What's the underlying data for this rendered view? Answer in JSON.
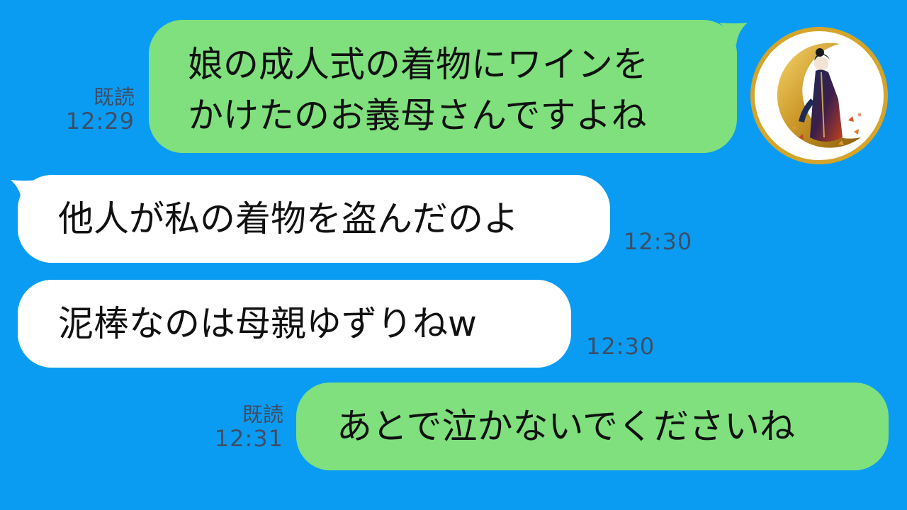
{
  "colors": {
    "background": "#0a9cf2",
    "sent_bubble": "#7fe07d",
    "received_bubble": "#ffffff",
    "meta_text": "#3d4e66",
    "avatar_ring": "#d4a52a"
  },
  "messages": [
    {
      "direction": "sent",
      "lines": [
        "娘の成人式の着物にワインを",
        "かけたのお義母さんですよね"
      ],
      "read_label": "既読",
      "time": "12:29"
    },
    {
      "direction": "received",
      "text": "他人が私の着物を盗んだのよ",
      "time": "12:30"
    },
    {
      "direction": "received",
      "text": "泥棒なのは母親ゆずりねw",
      "time": "12:30"
    },
    {
      "direction": "sent",
      "text": "あとで泣かないでくださいね",
      "read_label": "既読",
      "time": "12:31"
    }
  ],
  "avatar": {
    "icon": "crescent-moon-kimono-woman-avatar"
  }
}
